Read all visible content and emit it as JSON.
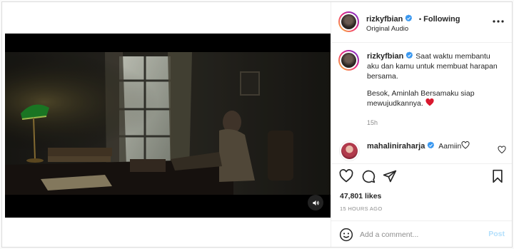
{
  "post": {
    "author": "rizkyfbian",
    "follow_sep": "•",
    "follow_label": "Following",
    "audio": "Original Audio",
    "more_icon": "more-horizontal-icon"
  },
  "caption": {
    "author": "rizkyfbian",
    "line1": "Saat waktu membantu aku dan kamu untuk membuat harapan bersama.",
    "line2": "Besok, Aminlah Bersamaku siap mewujudkannya.",
    "emoji": "❤️",
    "time": "15h"
  },
  "comment": {
    "author": "mahaliniraharja",
    "text": "Aamiin",
    "emoji": "🤍"
  },
  "stats": {
    "likes": "47,801 likes",
    "ago": "15 HOURS AGO"
  },
  "add_comment": {
    "placeholder": "Add a comment...",
    "post_label": "Post"
  },
  "colors": {
    "accent": "#0095f6",
    "post_disabled": "#b2dffc",
    "heart": "#ed4956",
    "verified": "#3897f0"
  }
}
